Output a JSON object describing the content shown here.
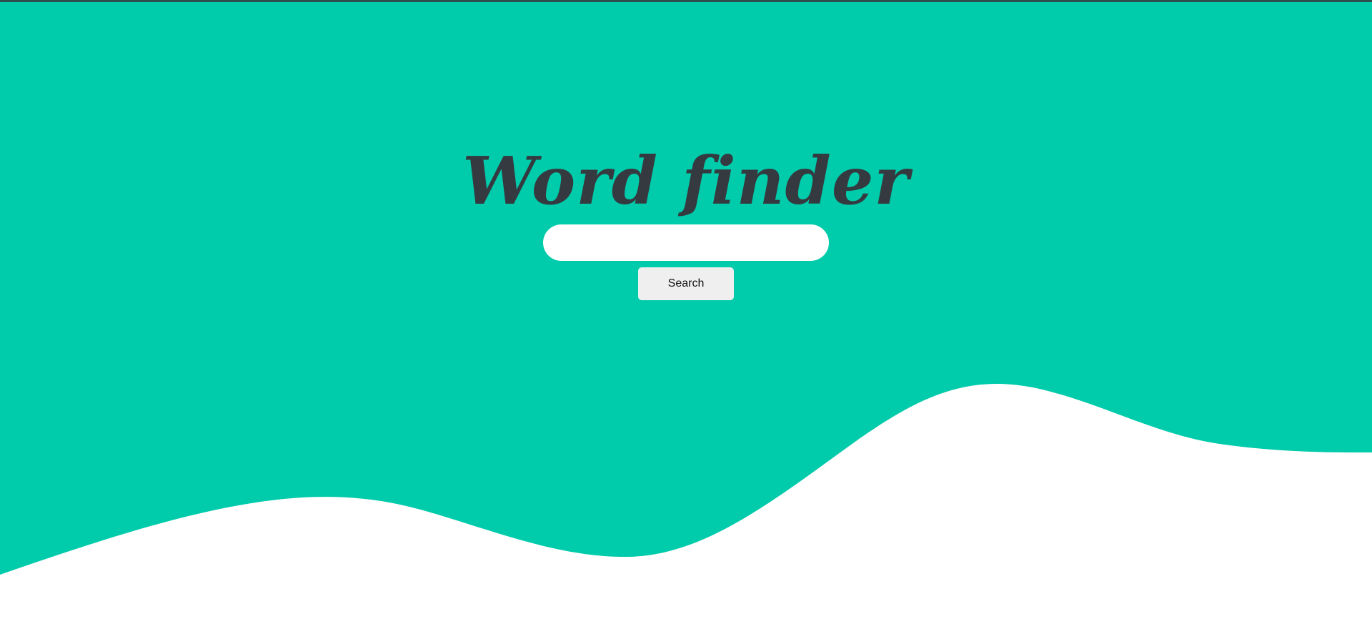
{
  "page": {
    "title": "Word finder"
  },
  "search": {
    "input_value": "",
    "input_placeholder": "",
    "button_label": "Search"
  },
  "colors": {
    "background": "#00CBAA",
    "page": "#FFFFFF",
    "title": "#353A40",
    "button": "#EFEFEF"
  }
}
